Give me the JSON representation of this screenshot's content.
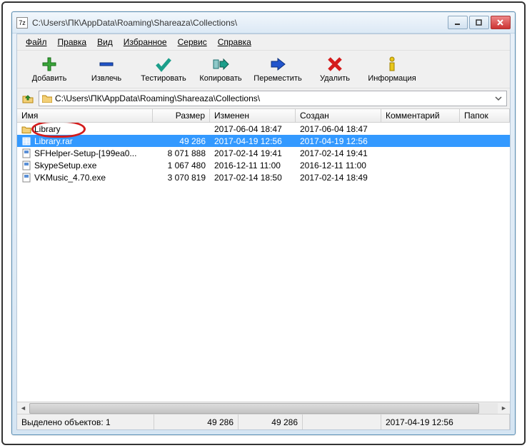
{
  "window": {
    "title": "C:\\Users\\ПК\\AppData\\Roaming\\Shareaza\\Collections\\",
    "app_icon_text": "7z"
  },
  "menu": [
    "Файл",
    "Правка",
    "Вид",
    "Избранное",
    "Сервис",
    "Справка"
  ],
  "toolbar": {
    "add": "Добавить",
    "extract": "Извлечь",
    "test": "Тестировать",
    "copy": "Копировать",
    "move": "Переместить",
    "delete": "Удалить",
    "info": "Информация"
  },
  "address": "C:\\Users\\ПК\\AppData\\Roaming\\Shareaza\\Collections\\",
  "columns": {
    "name": "Имя",
    "size": "Размер",
    "modified": "Изменен",
    "created": "Создан",
    "comment": "Комментарий",
    "folders": "Папок"
  },
  "rows": [
    {
      "icon": "folder",
      "name": "Library",
      "size": "",
      "modified": "2017-06-04 18:47",
      "created": "2017-06-04 18:47",
      "selected": false
    },
    {
      "icon": "archive",
      "name": "Library.rar",
      "size": "49 286",
      "modified": "2017-04-19 12:56",
      "created": "2017-04-19 12:56",
      "selected": true
    },
    {
      "icon": "exe",
      "name": "SFHelper-Setup-[199ea0...",
      "size": "8 071 888",
      "modified": "2017-02-14 19:41",
      "created": "2017-02-14 19:41",
      "selected": false
    },
    {
      "icon": "exe",
      "name": "SkypeSetup.exe",
      "size": "1 067 480",
      "modified": "2016-12-11 11:00",
      "created": "2016-12-11 11:00",
      "selected": false
    },
    {
      "icon": "exe",
      "name": "VKMusic_4.70.exe",
      "size": "3 070 819",
      "modified": "2017-02-14 18:50",
      "created": "2017-02-14 18:49",
      "selected": false
    }
  ],
  "status": {
    "selected_label": "Выделено объектов: 1",
    "size1": "49 286",
    "size2": "49 286",
    "date": "2017-04-19 12:56"
  },
  "colors": {
    "selection": "#3399ff",
    "annotation": "#d41c1c"
  }
}
